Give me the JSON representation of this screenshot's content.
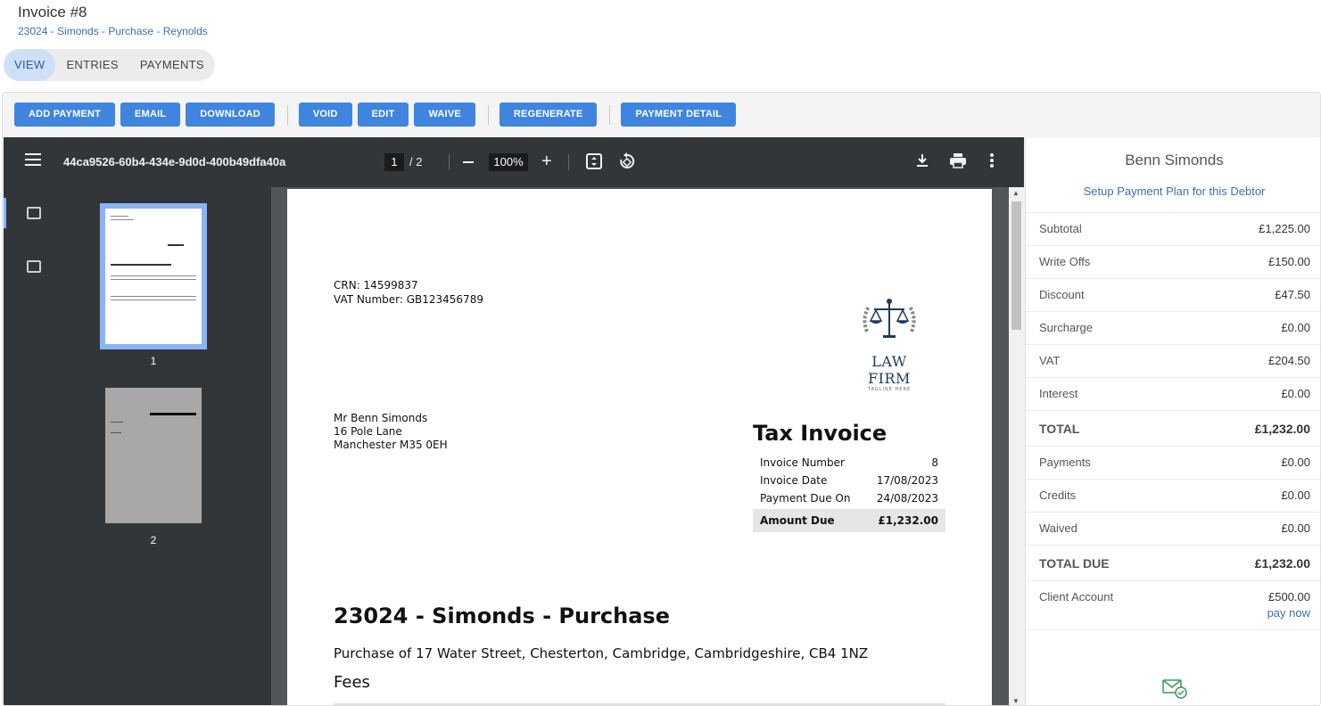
{
  "header": {
    "title": "Invoice #8",
    "subtitle": "23024 - Simonds - Purchase - Reynolds"
  },
  "tabs": [
    {
      "label": "VIEW",
      "active": true
    },
    {
      "label": "ENTRIES",
      "active": false
    },
    {
      "label": "PAYMENTS",
      "active": false
    }
  ],
  "toolbar": {
    "add_payment": "ADD PAYMENT",
    "email": "EMAIL",
    "download": "DOWNLOAD",
    "void": "VOID",
    "edit": "EDIT",
    "waive": "WAIVE",
    "regenerate": "REGENERATE",
    "payment_detail": "PAYMENT DETAIL"
  },
  "viewer": {
    "filename": "44ca9526-60b4-434e-9d0d-400b49dfa40a",
    "current_page": "1",
    "total_pages": "/  2",
    "zoom": "100%",
    "thumb_labels": [
      "1",
      "2"
    ],
    "icons": [
      "menu-icon",
      "zoom-out-icon",
      "zoom-in-icon",
      "fit-page-icon",
      "rotate-icon",
      "download-icon",
      "print-icon",
      "more-icon",
      "thumbnails-icon",
      "outline-icon"
    ]
  },
  "document": {
    "crn": "CRN: 14599837",
    "vat_number": "VAT Number: GB123456789",
    "logo_name": "LAW FIRM",
    "logo_tagline": "TAGLINE HERE",
    "address": [
      "Mr Benn Simonds",
      "16 Pole Lane",
      "Manchester M35 0EH"
    ],
    "doc_title": "Tax Invoice",
    "invoice_rows": [
      {
        "label": "Invoice Number",
        "value": "8"
      },
      {
        "label": "Invoice Date",
        "value": "17/08/2023"
      },
      {
        "label": "Payment Due On",
        "value": "24/08/2023"
      }
    ],
    "amount_due": {
      "label": "Amount Due",
      "value": "£1,232.00"
    },
    "matter_title": "23024 - Simonds - Purchase",
    "matter_desc": "Purchase of 17 Water Street, Chesterton, Cambridge, Cambridgeshire, CB4 1NZ",
    "fees_heading": "Fees"
  },
  "summary": {
    "debtor": "Benn Simonds",
    "plan_link": "Setup Payment Plan for this Debtor",
    "rows": [
      {
        "label": "Subtotal",
        "value": "£1,225.00"
      },
      {
        "label": "Write Offs",
        "value": "£150.00"
      },
      {
        "label": "Discount",
        "value": "£47.50"
      },
      {
        "label": "Surcharge",
        "value": "£0.00"
      },
      {
        "label": "VAT",
        "value": "£204.50"
      },
      {
        "label": "Interest",
        "value": "£0.00"
      },
      {
        "label": "TOTAL",
        "value": "£1,232.00"
      },
      {
        "label": "Payments",
        "value": "£0.00"
      },
      {
        "label": "Credits",
        "value": "£0.00"
      },
      {
        "label": "Waived",
        "value": "£0.00"
      },
      {
        "label": "TOTAL DUE",
        "value": "£1,232.00"
      },
      {
        "label": "Client Account",
        "value": "£500.00"
      }
    ],
    "pay_now": "pay now"
  },
  "colors": {
    "accent": "#3f85e0",
    "link": "#3a6fb0",
    "viewer_bg": "#525659",
    "viewer_toolbar": "#323639"
  }
}
